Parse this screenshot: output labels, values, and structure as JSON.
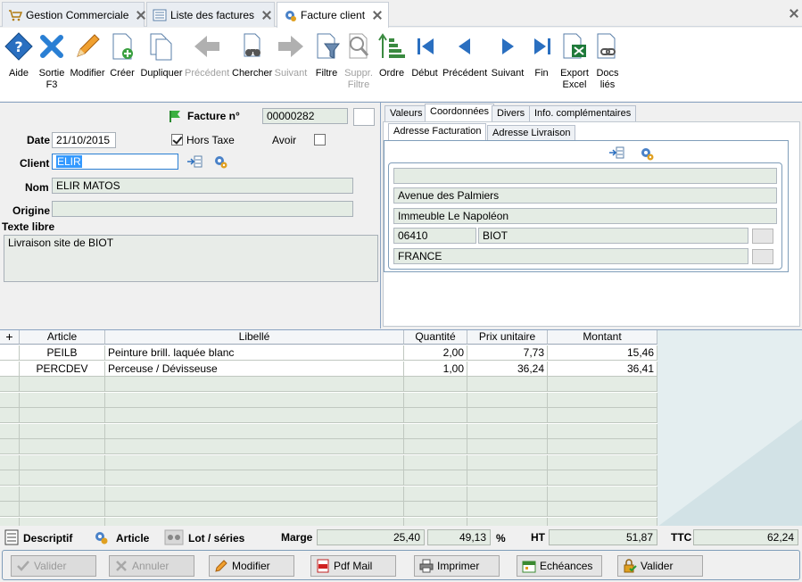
{
  "tabs": [
    {
      "label": "Gestion Commerciale",
      "active": false
    },
    {
      "label": "Liste des factures",
      "active": false
    },
    {
      "label": "Facture client",
      "active": true
    }
  ],
  "toolbar": {
    "aide": "Aide",
    "sortie": "Sortie F3",
    "modifier": "Modifier",
    "creer": "Créer",
    "dupliquer": "Dupliquer",
    "precedent": "Précédent",
    "chercher": "Chercher",
    "suivant": "Suivant",
    "filtre": "Filtre",
    "suppr_filtre": "Suppr. Filtre",
    "ordre": "Ordre",
    "debut": "Début",
    "precedent2": "Précédent",
    "suivant2": "Suivant",
    "fin": "Fin",
    "export_excel": "Export Excel",
    "docs_lies": "Docs liés"
  },
  "form": {
    "facture_label": "Facture n°",
    "facture_no": "00000282",
    "date_label": "Date",
    "date": "21/10/2015",
    "hors_taxe_label": "Hors Taxe",
    "hors_taxe_checked": true,
    "avoir_label": "Avoir",
    "avoir_checked": false,
    "client_label": "Client",
    "client": "ELIR",
    "nom_label": "Nom",
    "nom": "ELIR MATOS",
    "origine_label": "Origine",
    "origine": "",
    "texte_libre_label": "Texte libre",
    "texte_libre": "Livraison site de BIOT"
  },
  "right_tabs": [
    "Valeurs",
    "Coordonnées",
    "Divers",
    "Info. complémentaires"
  ],
  "sub_tabs": [
    "Adresse Facturation",
    "Adresse Livraison"
  ],
  "address": {
    "line0": "",
    "line1": "Avenue des Palmiers",
    "line2": "Immeuble Le Napoléon",
    "cp": "06410",
    "ville": "BIOT",
    "pays": "FRANCE"
  },
  "grid": {
    "columns": [
      "Article",
      "Libellé",
      "Quantité",
      "Prix unitaire",
      "Montant"
    ],
    "rows": [
      {
        "article": "PEILB",
        "libelle": "Peinture brill. laquée blanc",
        "quantite": "2,00",
        "prix": "7,73",
        "montant": "15,46"
      },
      {
        "article": "PERCDEV",
        "libelle": "Perceuse / Dévisseuse",
        "quantite": "1,00",
        "prix": "36,24",
        "montant": "36,41"
      }
    ],
    "empty_rows": 10
  },
  "totals": {
    "descriptif": "Descriptif",
    "article": "Article",
    "lot_series": "Lot / séries",
    "marge_label": "Marge",
    "marge": "25,40",
    "marge_pct": "49,13",
    "pct": "%",
    "ht_label": "HT",
    "ht": "51,87",
    "ttc_label": "TTC",
    "ttc": "62,24"
  },
  "buttons": {
    "valider_disabled": "Valider",
    "annuler": "Annuler",
    "modifier": "Modifier",
    "pdf_mail": "Pdf Mail",
    "imprimer": "Imprimer",
    "echeances": "Echéances",
    "valider": "Valider"
  },
  "colors": {
    "accent": "#2a7fd4",
    "field_bg": "#e4ece4",
    "panel_border": "#7f9db9"
  }
}
